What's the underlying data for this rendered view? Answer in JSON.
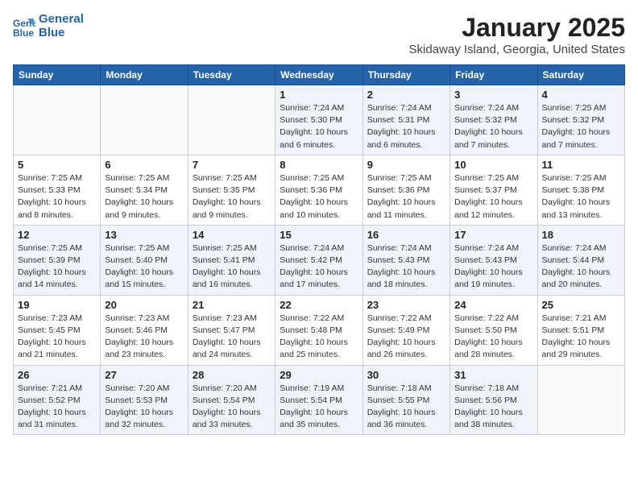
{
  "header": {
    "logo_line1": "General",
    "logo_line2": "Blue",
    "month": "January 2025",
    "location": "Skidaway Island, Georgia, United States"
  },
  "weekdays": [
    "Sunday",
    "Monday",
    "Tuesday",
    "Wednesday",
    "Thursday",
    "Friday",
    "Saturday"
  ],
  "weeks": [
    [
      {
        "day": "",
        "sunrise": "",
        "sunset": "",
        "daylight": ""
      },
      {
        "day": "",
        "sunrise": "",
        "sunset": "",
        "daylight": ""
      },
      {
        "day": "",
        "sunrise": "",
        "sunset": "",
        "daylight": ""
      },
      {
        "day": "1",
        "sunrise": "Sunrise: 7:24 AM",
        "sunset": "Sunset: 5:30 PM",
        "daylight": "Daylight: 10 hours and 6 minutes."
      },
      {
        "day": "2",
        "sunrise": "Sunrise: 7:24 AM",
        "sunset": "Sunset: 5:31 PM",
        "daylight": "Daylight: 10 hours and 6 minutes."
      },
      {
        "day": "3",
        "sunrise": "Sunrise: 7:24 AM",
        "sunset": "Sunset: 5:32 PM",
        "daylight": "Daylight: 10 hours and 7 minutes."
      },
      {
        "day": "4",
        "sunrise": "Sunrise: 7:25 AM",
        "sunset": "Sunset: 5:32 PM",
        "daylight": "Daylight: 10 hours and 7 minutes."
      }
    ],
    [
      {
        "day": "5",
        "sunrise": "Sunrise: 7:25 AM",
        "sunset": "Sunset: 5:33 PM",
        "daylight": "Daylight: 10 hours and 8 minutes."
      },
      {
        "day": "6",
        "sunrise": "Sunrise: 7:25 AM",
        "sunset": "Sunset: 5:34 PM",
        "daylight": "Daylight: 10 hours and 9 minutes."
      },
      {
        "day": "7",
        "sunrise": "Sunrise: 7:25 AM",
        "sunset": "Sunset: 5:35 PM",
        "daylight": "Daylight: 10 hours and 9 minutes."
      },
      {
        "day": "8",
        "sunrise": "Sunrise: 7:25 AM",
        "sunset": "Sunset: 5:36 PM",
        "daylight": "Daylight: 10 hours and 10 minutes."
      },
      {
        "day": "9",
        "sunrise": "Sunrise: 7:25 AM",
        "sunset": "Sunset: 5:36 PM",
        "daylight": "Daylight: 10 hours and 11 minutes."
      },
      {
        "day": "10",
        "sunrise": "Sunrise: 7:25 AM",
        "sunset": "Sunset: 5:37 PM",
        "daylight": "Daylight: 10 hours and 12 minutes."
      },
      {
        "day": "11",
        "sunrise": "Sunrise: 7:25 AM",
        "sunset": "Sunset: 5:38 PM",
        "daylight": "Daylight: 10 hours and 13 minutes."
      }
    ],
    [
      {
        "day": "12",
        "sunrise": "Sunrise: 7:25 AM",
        "sunset": "Sunset: 5:39 PM",
        "daylight": "Daylight: 10 hours and 14 minutes."
      },
      {
        "day": "13",
        "sunrise": "Sunrise: 7:25 AM",
        "sunset": "Sunset: 5:40 PM",
        "daylight": "Daylight: 10 hours and 15 minutes."
      },
      {
        "day": "14",
        "sunrise": "Sunrise: 7:25 AM",
        "sunset": "Sunset: 5:41 PM",
        "daylight": "Daylight: 10 hours and 16 minutes."
      },
      {
        "day": "15",
        "sunrise": "Sunrise: 7:24 AM",
        "sunset": "Sunset: 5:42 PM",
        "daylight": "Daylight: 10 hours and 17 minutes."
      },
      {
        "day": "16",
        "sunrise": "Sunrise: 7:24 AM",
        "sunset": "Sunset: 5:43 PM",
        "daylight": "Daylight: 10 hours and 18 minutes."
      },
      {
        "day": "17",
        "sunrise": "Sunrise: 7:24 AM",
        "sunset": "Sunset: 5:43 PM",
        "daylight": "Daylight: 10 hours and 19 minutes."
      },
      {
        "day": "18",
        "sunrise": "Sunrise: 7:24 AM",
        "sunset": "Sunset: 5:44 PM",
        "daylight": "Daylight: 10 hours and 20 minutes."
      }
    ],
    [
      {
        "day": "19",
        "sunrise": "Sunrise: 7:23 AM",
        "sunset": "Sunset: 5:45 PM",
        "daylight": "Daylight: 10 hours and 21 minutes."
      },
      {
        "day": "20",
        "sunrise": "Sunrise: 7:23 AM",
        "sunset": "Sunset: 5:46 PM",
        "daylight": "Daylight: 10 hours and 23 minutes."
      },
      {
        "day": "21",
        "sunrise": "Sunrise: 7:23 AM",
        "sunset": "Sunset: 5:47 PM",
        "daylight": "Daylight: 10 hours and 24 minutes."
      },
      {
        "day": "22",
        "sunrise": "Sunrise: 7:22 AM",
        "sunset": "Sunset: 5:48 PM",
        "daylight": "Daylight: 10 hours and 25 minutes."
      },
      {
        "day": "23",
        "sunrise": "Sunrise: 7:22 AM",
        "sunset": "Sunset: 5:49 PM",
        "daylight": "Daylight: 10 hours and 26 minutes."
      },
      {
        "day": "24",
        "sunrise": "Sunrise: 7:22 AM",
        "sunset": "Sunset: 5:50 PM",
        "daylight": "Daylight: 10 hours and 28 minutes."
      },
      {
        "day": "25",
        "sunrise": "Sunrise: 7:21 AM",
        "sunset": "Sunset: 5:51 PM",
        "daylight": "Daylight: 10 hours and 29 minutes."
      }
    ],
    [
      {
        "day": "26",
        "sunrise": "Sunrise: 7:21 AM",
        "sunset": "Sunset: 5:52 PM",
        "daylight": "Daylight: 10 hours and 31 minutes."
      },
      {
        "day": "27",
        "sunrise": "Sunrise: 7:20 AM",
        "sunset": "Sunset: 5:53 PM",
        "daylight": "Daylight: 10 hours and 32 minutes."
      },
      {
        "day": "28",
        "sunrise": "Sunrise: 7:20 AM",
        "sunset": "Sunset: 5:54 PM",
        "daylight": "Daylight: 10 hours and 33 minutes."
      },
      {
        "day": "29",
        "sunrise": "Sunrise: 7:19 AM",
        "sunset": "Sunset: 5:54 PM",
        "daylight": "Daylight: 10 hours and 35 minutes."
      },
      {
        "day": "30",
        "sunrise": "Sunrise: 7:18 AM",
        "sunset": "Sunset: 5:55 PM",
        "daylight": "Daylight: 10 hours and 36 minutes."
      },
      {
        "day": "31",
        "sunrise": "Sunrise: 7:18 AM",
        "sunset": "Sunset: 5:56 PM",
        "daylight": "Daylight: 10 hours and 38 minutes."
      },
      {
        "day": "",
        "sunrise": "",
        "sunset": "",
        "daylight": ""
      }
    ]
  ]
}
